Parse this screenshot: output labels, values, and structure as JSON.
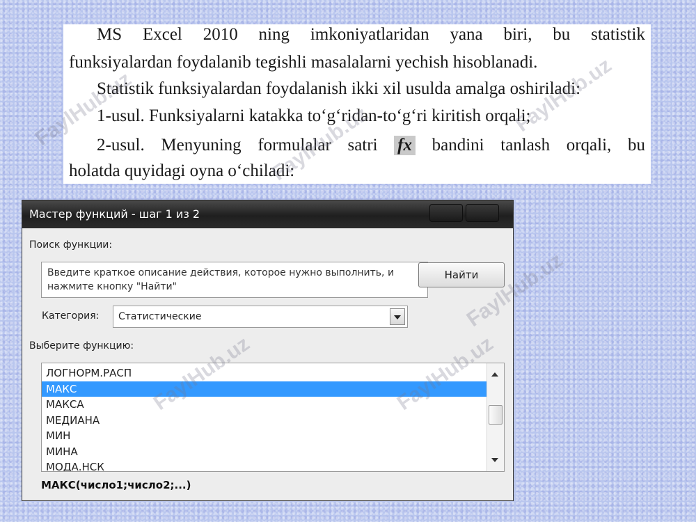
{
  "document": {
    "lines": [
      [
        "MS",
        "Excel",
        "2010",
        "ning",
        "imkoniyatlaridan",
        "yana",
        "biri,",
        "bu",
        "statistik"
      ],
      "funksiyalardan foydalanib tegishli masalalarni yechish hisoblanadi.",
      "Statistik funksiyalardan foydalanish ikki xil usulda amalga oshiriladi:",
      "1-usul. Funksiyalarni katakka to‘g‘ridan-to‘g‘ri kiritish orqali;",
      {
        "words": [
          "2-usul.",
          "Menyuning",
          "formulalar",
          "satri"
        ],
        "fx": "fx",
        "after": [
          "bandini",
          "tanlash",
          "orqali,",
          "bu"
        ]
      },
      "holatda quyidagi oyna o‘chiladi:"
    ]
  },
  "watermark": "FaylHub.uz",
  "dialog": {
    "title": "Мастер функций - шаг 1 из 2",
    "search_label": "Поиск функции:",
    "search_text": "Введите краткое описание действия, которое нужно выполнить, и нажмите кнопку \"Найти\"",
    "find_button": "Найти",
    "category_label": "Категория:",
    "category_value": "Статистические",
    "choose_label": "Выберите функцию:",
    "functions": [
      "ЛОГНОРМ.РАСП",
      "МАКС",
      "МАКСА",
      "МЕДИАНА",
      "МИН",
      "МИНА",
      "МОДА.НСК"
    ],
    "selected_index": 1,
    "signature": "МАКС(число1;число2;...)"
  }
}
